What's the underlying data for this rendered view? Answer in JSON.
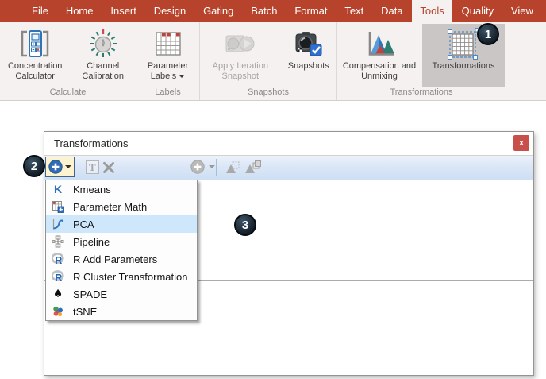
{
  "ribbon": {
    "tabs": [
      "File",
      "Home",
      "Insert",
      "Design",
      "Gating",
      "Batch",
      "Format",
      "Text",
      "Data",
      "Tools",
      "Quality",
      "View"
    ],
    "selected_tab": "Tools",
    "groups": [
      {
        "label": "Calculate"
      },
      {
        "label": "Labels"
      },
      {
        "label": "Snapshots"
      },
      {
        "label": "Transformations"
      }
    ],
    "buttons": {
      "concentration_calculator": "Concentration Calculator",
      "channel_calibration": "Channel Calibration",
      "parameter_labels": "Parameter Labels",
      "apply_iteration_snapshot": "Apply Iteration Snapshot",
      "snapshots": "Snapshots",
      "compensation_unmixing": "Compensation and Unmixing",
      "transformations": "Transformations"
    }
  },
  "dialog": {
    "title": "Transformations",
    "close_label": "x"
  },
  "menu": {
    "items": [
      "Kmeans",
      "Parameter Math",
      "PCA",
      "Pipeline",
      "R Add Parameters",
      "R Cluster Transformation",
      "SPADE",
      "tSNE"
    ],
    "selected": "PCA"
  },
  "badges": {
    "step1": "1",
    "step2": "2",
    "step3": "3"
  },
  "icons": {
    "kmeans_letter": "K",
    "r_letter": "R",
    "spade_glyph": "♠",
    "text_tool_letter": "T"
  },
  "colors": {
    "ribbon_red": "#b7432c",
    "selection_blue": "#cfe7fa",
    "accent_blue": "#2e6db4",
    "close_red": "#c9504a",
    "active_button_gray": "#c9c6c5",
    "highlight_box_fill": "#fdf3cf"
  }
}
